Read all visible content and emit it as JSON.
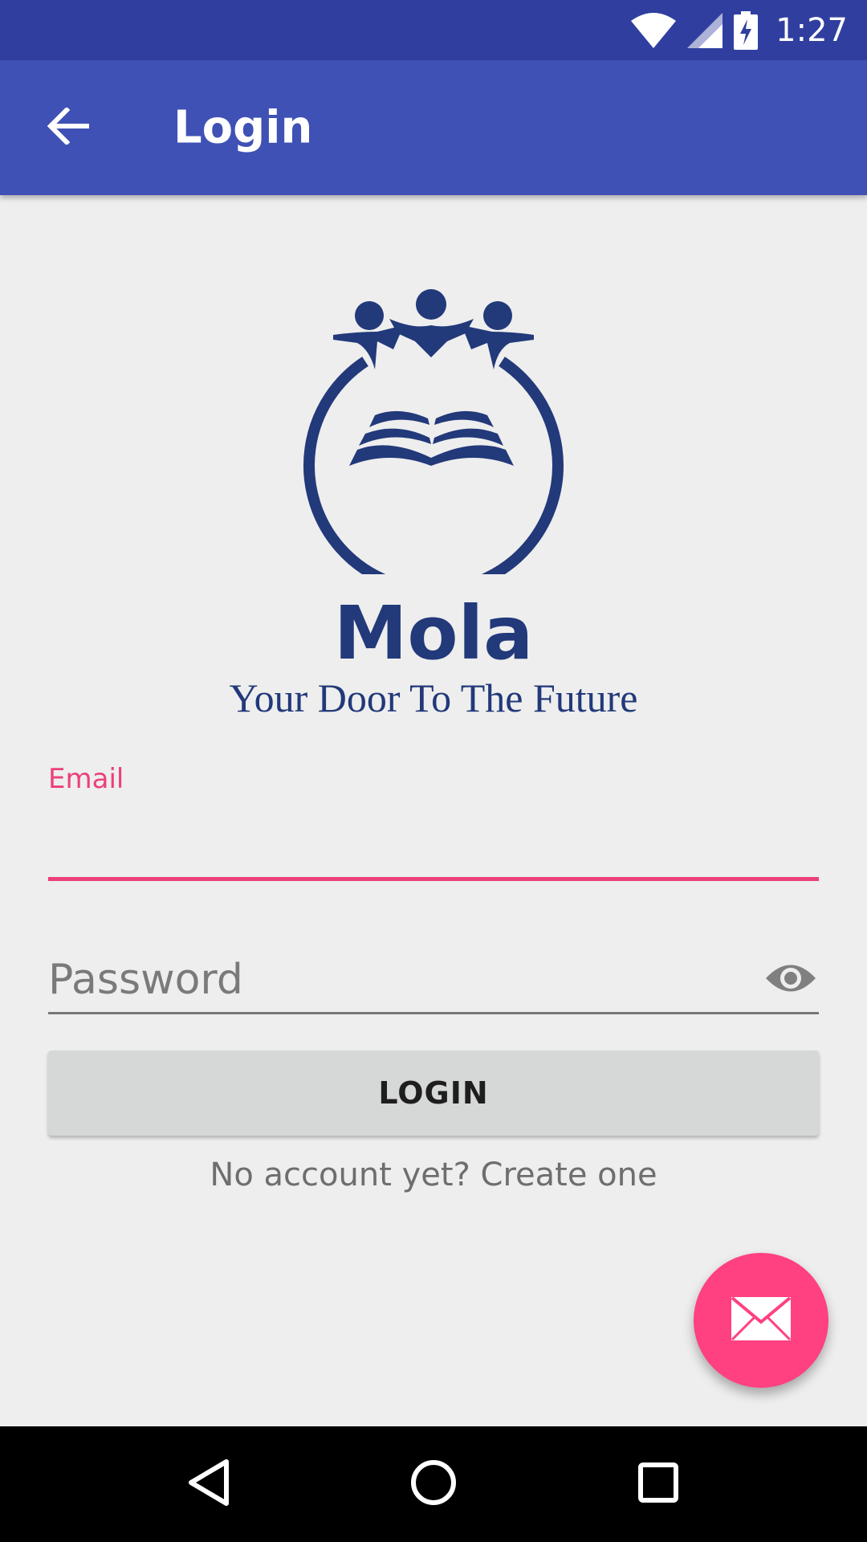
{
  "status_bar": {
    "time": "1:27",
    "icons": [
      "wifi-icon",
      "signal-icon",
      "battery-charging-icon"
    ]
  },
  "app_bar": {
    "title": "Login",
    "back_icon": "arrow-back-icon"
  },
  "branding": {
    "name": "Mola",
    "tagline": "Your Door To The Future",
    "brand_color": "#22397A"
  },
  "form": {
    "email_label": "Email",
    "email_value": "",
    "password_placeholder": "Password",
    "password_value": "",
    "visibility_icon": "eye-icon",
    "login_label": "LOGIN",
    "signup_text": "No account yet? Create one"
  },
  "fab": {
    "icon": "mail-icon",
    "color": "#FF4081"
  },
  "colors": {
    "primary": "#3F51B5",
    "primary_dark": "#303F9F",
    "accent": "#EC407A"
  },
  "nav_bar": {
    "icons": [
      "back-triangle-icon",
      "home-circle-icon",
      "recents-square-icon"
    ]
  }
}
